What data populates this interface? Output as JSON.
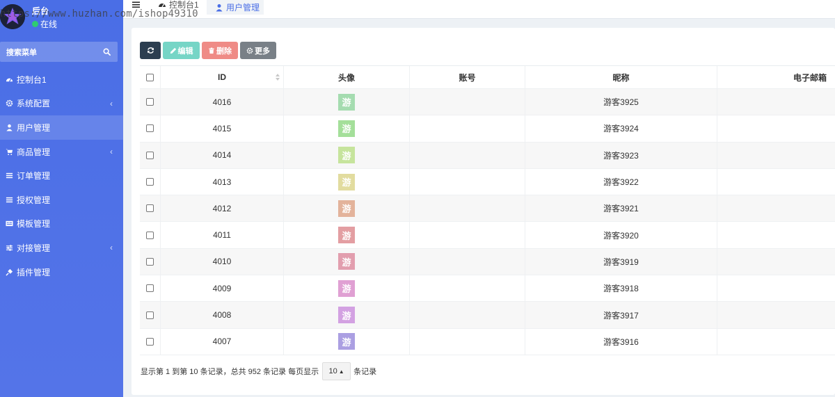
{
  "sidebar": {
    "brand": "后台",
    "status": "在线",
    "search_label": "搜索菜单",
    "items": [
      {
        "label": "控制台1",
        "icon": "dashboard-icon",
        "has_children": false,
        "active": false
      },
      {
        "label": "系统配置",
        "icon": "gear-icon",
        "has_children": true,
        "active": false
      },
      {
        "label": "用户管理",
        "icon": "user-icon",
        "has_children": false,
        "active": true
      },
      {
        "label": "商品管理",
        "icon": "cart-icon",
        "has_children": true,
        "active": false
      },
      {
        "label": "订单管理",
        "icon": "list-icon",
        "has_children": false,
        "active": false
      },
      {
        "label": "授权管理",
        "icon": "list-icon",
        "has_children": false,
        "active": false
      },
      {
        "label": "模板管理",
        "icon": "template-icon",
        "has_children": false,
        "active": false
      },
      {
        "label": "对接管理",
        "icon": "sliders-icon",
        "has_children": true,
        "active": false
      },
      {
        "label": "插件管理",
        "icon": "plug-icon",
        "has_children": false,
        "active": false
      }
    ],
    "chevron": "‹"
  },
  "topbar": {
    "tabs": [
      {
        "label": "控制台1",
        "icon": "dashboard-icon"
      },
      {
        "label": "用户管理",
        "icon": "user-icon"
      }
    ],
    "watermark": "https://www.huzhan.com/ishop49310"
  },
  "toolbar": {
    "edit_label": "编辑",
    "delete_label": "删除",
    "more_label": "更多"
  },
  "table": {
    "columns": [
      "ID",
      "头像",
      "账号",
      "昵称",
      "电子邮箱"
    ],
    "rows": [
      {
        "id": "4016",
        "avatar_text": "游",
        "avatar_color": "#a5dcb0",
        "account": "",
        "nickname": "游客3925",
        "email": ""
      },
      {
        "id": "4015",
        "avatar_text": "游",
        "avatar_color": "#a4df9a",
        "account": "",
        "nickname": "游客3924",
        "email": ""
      },
      {
        "id": "4014",
        "avatar_text": "游",
        "avatar_color": "#c6e49c",
        "account": "",
        "nickname": "游客3923",
        "email": ""
      },
      {
        "id": "4013",
        "avatar_text": "游",
        "avatar_color": "#e2dc9f",
        "account": "",
        "nickname": "游客3922",
        "email": ""
      },
      {
        "id": "4012",
        "avatar_text": "游",
        "avatar_color": "#e3b39b",
        "account": "",
        "nickname": "游客3921",
        "email": ""
      },
      {
        "id": "4011",
        "avatar_text": "游",
        "avatar_color": "#e39ea2",
        "account": "",
        "nickname": "游客3920",
        "email": ""
      },
      {
        "id": "4010",
        "avatar_text": "游",
        "avatar_color": "#e29eae",
        "account": "",
        "nickname": "游客3919",
        "email": ""
      },
      {
        "id": "4009",
        "avatar_text": "游",
        "avatar_color": "#e0a0d3",
        "account": "",
        "nickname": "游客3918",
        "email": ""
      },
      {
        "id": "4008",
        "avatar_text": "游",
        "avatar_color": "#d3a1e2",
        "account": "",
        "nickname": "游客3917",
        "email": ""
      },
      {
        "id": "4007",
        "avatar_text": "游",
        "avatar_color": "#ab9fe2",
        "account": "",
        "nickname": "游客3916",
        "email": ""
      }
    ]
  },
  "pager": {
    "summary": "显示第 1 到第 10 条记录，总共 952 条记录 每页显示",
    "page_size": "10",
    "suffix": "条记录"
  },
  "colors": {
    "sidebar": "#4a6ee6",
    "accent": "#4a6ee6",
    "refresh_button": "#2c3e50",
    "edit_button": "#76d5c6",
    "delete_button": "#ef8b86",
    "more_button": "#798087",
    "online_dot": "#2ecc71"
  }
}
